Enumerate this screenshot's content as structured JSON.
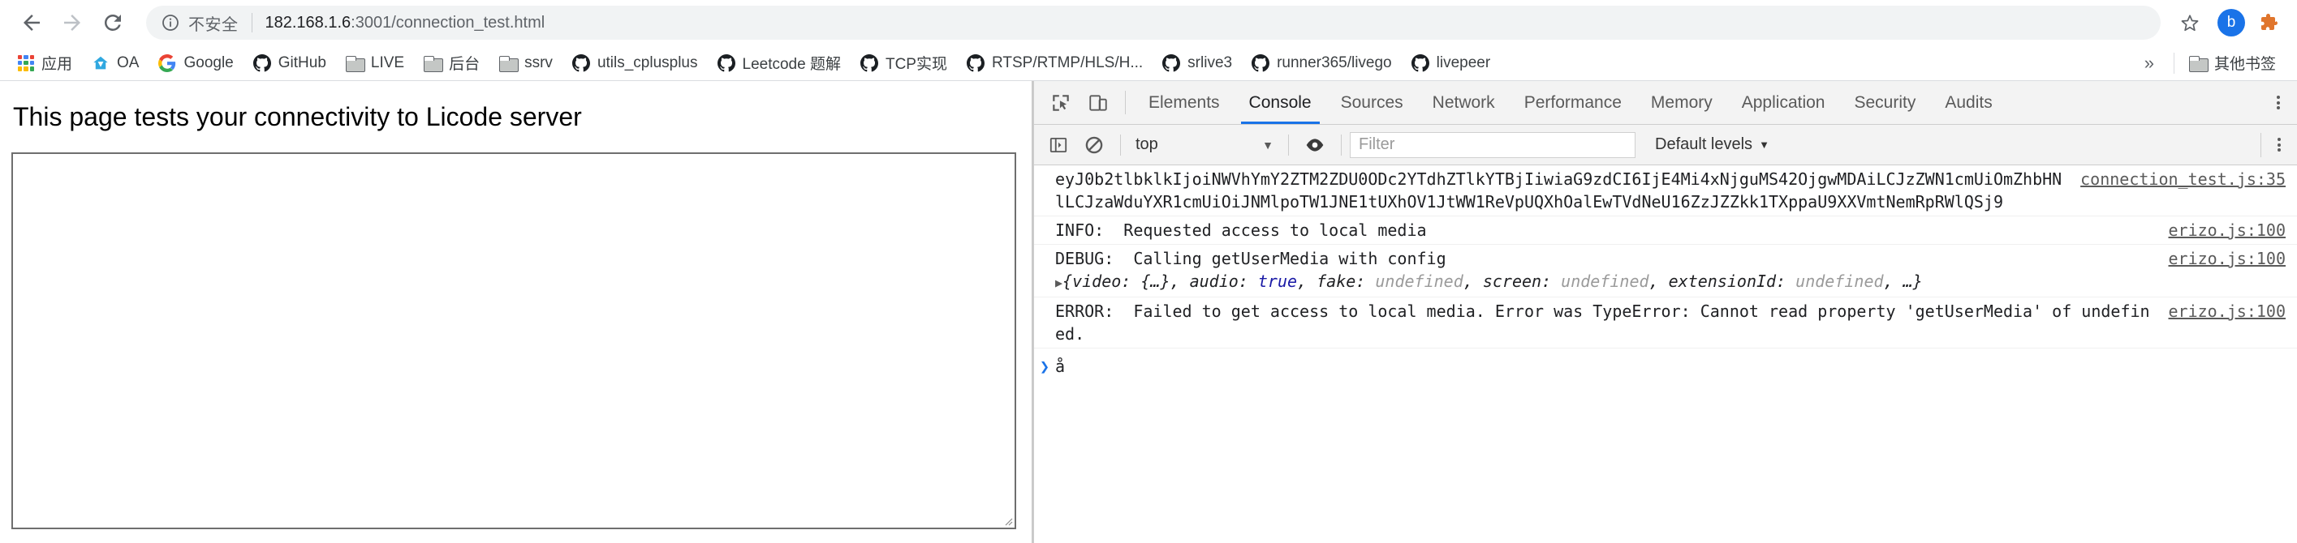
{
  "browser": {
    "nav": {
      "back": "back-arrow",
      "forward": "forward-arrow",
      "reload": "reload"
    },
    "omnibox": {
      "security_icon": "info-circle-icon",
      "security_text": "不安全",
      "url_host": "182.168.1.6",
      "url_rest": ":3001/connection_test.html",
      "url_full": "182.168.1.6:3001/connection_test.html"
    },
    "star_icon": "star-icon",
    "avatar_letter": "b",
    "extension_icon": "puzzle-icon",
    "accent": "#1a73e8"
  },
  "bookmarks": {
    "apps_label": "应用",
    "items": [
      {
        "label": "OA",
        "icon": "home-icon"
      },
      {
        "label": "Google",
        "icon": "google-icon"
      },
      {
        "label": "GitHub",
        "icon": "github-icon"
      },
      {
        "label": "LIVE",
        "icon": "folder-icon"
      },
      {
        "label": "后台",
        "icon": "folder-icon"
      },
      {
        "label": "ssrv",
        "icon": "folder-icon"
      },
      {
        "label": "utils_cplusplus",
        "icon": "github-icon"
      },
      {
        "label": "Leetcode 题解",
        "icon": "github-icon"
      },
      {
        "label": "TCP实现",
        "icon": "github-icon"
      },
      {
        "label": "RTSP/RTMP/HLS/H...",
        "icon": "github-icon"
      },
      {
        "label": "srlive3",
        "icon": "github-icon"
      },
      {
        "label": "runner365/livego",
        "icon": "github-icon"
      },
      {
        "label": "livepeer",
        "icon": "github-icon"
      }
    ],
    "overflow_label": "»",
    "other_bookmarks": {
      "label": "其他书签",
      "icon": "folder-icon"
    }
  },
  "page": {
    "heading": "This page tests your connectivity to Licode server"
  },
  "devtools": {
    "inspect_icon": "inspect-element-icon",
    "device_icon": "device-toolbar-icon",
    "tabs": [
      {
        "label": "Elements",
        "active": false
      },
      {
        "label": "Console",
        "active": true
      },
      {
        "label": "Sources",
        "active": false
      },
      {
        "label": "Network",
        "active": false
      },
      {
        "label": "Performance",
        "active": false
      },
      {
        "label": "Memory",
        "active": false
      },
      {
        "label": "Application",
        "active": false
      },
      {
        "label": "Security",
        "active": false
      },
      {
        "label": "Audits",
        "active": false
      }
    ],
    "more_icon": "kebab-menu-icon",
    "filterbar": {
      "sidebar_icon": "show-console-sidebar-icon",
      "clear_icon": "clear-console-icon",
      "context": "top",
      "context_caret": "▼",
      "eye_icon": "live-expression-icon",
      "filter_placeholder": "Filter",
      "levels": "Default levels",
      "levels_caret": "▼",
      "settings_icon": "gear-icon"
    },
    "console": {
      "messages": [
        {
          "id": "token-msg",
          "type": "log",
          "text": "eyJ0b2tlbklkIjoiNWVhYmY2ZTM2ZDU0ODc2YTdhZTlkYTBjIiwiaG9zdCI6IjE4Mi4xNjguMS42OjgwMDAiLCJzZWN1cmUiOmZhbHNlLCJzaWduYXR1cmUiOiJNMlpoTW1JNE1tUXhOV1JtWW1ReVpUQXhOalEwTVdNeU16ZzJZZkk1TXppaU9XXVmtNemRpRWlQSj9",
          "source": "connection_test.js:35"
        },
        {
          "id": "info-msg",
          "type": "info",
          "text": "INFO:  Requested access to local media",
          "source": "erizo.js:100"
        },
        {
          "id": "debug-msg",
          "type": "debug",
          "text": "DEBUG:  Calling getUserMedia with config",
          "object_preview": "{video: {…}, audio: true, fake: undefined, screen: undefined, extensionId: undefined, …}",
          "expand_triangle": "▶",
          "source": "erizo.js:100"
        },
        {
          "id": "error-msg",
          "type": "error",
          "text": "ERROR:  Failed to get access to local media. Error was TypeError: Cannot read property 'getUserMedia' of undefined.",
          "source": "erizo.js:100"
        }
      ],
      "prompt_chevron": "❯",
      "prompt_value": "å"
    }
  }
}
